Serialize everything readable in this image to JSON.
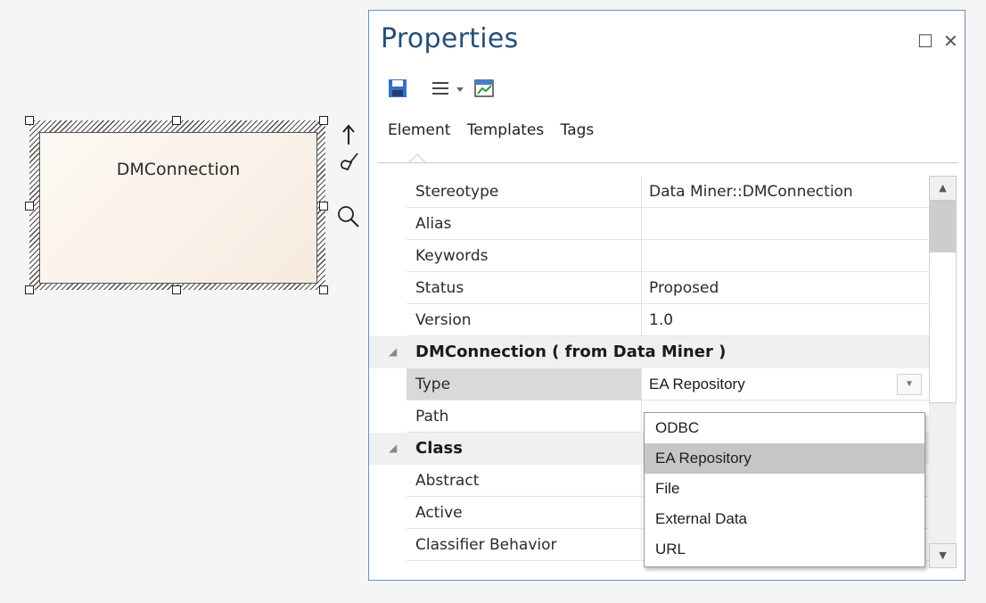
{
  "diagram": {
    "element_name": "DMConnection"
  },
  "properties": {
    "title": "Properties",
    "tabs": [
      "Element",
      "Templates",
      "Tags"
    ],
    "rows": [
      {
        "label": "Stereotype",
        "value": "Data Miner::DMConnection"
      },
      {
        "label": "Alias",
        "value": ""
      },
      {
        "label": "Keywords",
        "value": ""
      },
      {
        "label": "Status",
        "value": "Proposed"
      },
      {
        "label": "Version",
        "value": "1.0"
      }
    ],
    "category_dm": "DMConnection  ( from  Data Miner )",
    "type_row": {
      "label": "Type",
      "value": "EA Repository"
    },
    "path_row": {
      "label": "Path"
    },
    "category_class": "Class",
    "class_rows": [
      "Abstract",
      "Active",
      "Classifier Behavior"
    ]
  },
  "dropdown": {
    "options": [
      "ODBC",
      "EA Repository",
      "File",
      "External Data",
      "URL"
    ],
    "selected": "EA Repository"
  },
  "colors": {
    "title_blue": "#264f78",
    "window_border": "#6b8fc2",
    "selection_gray": "#c6c6c6"
  }
}
